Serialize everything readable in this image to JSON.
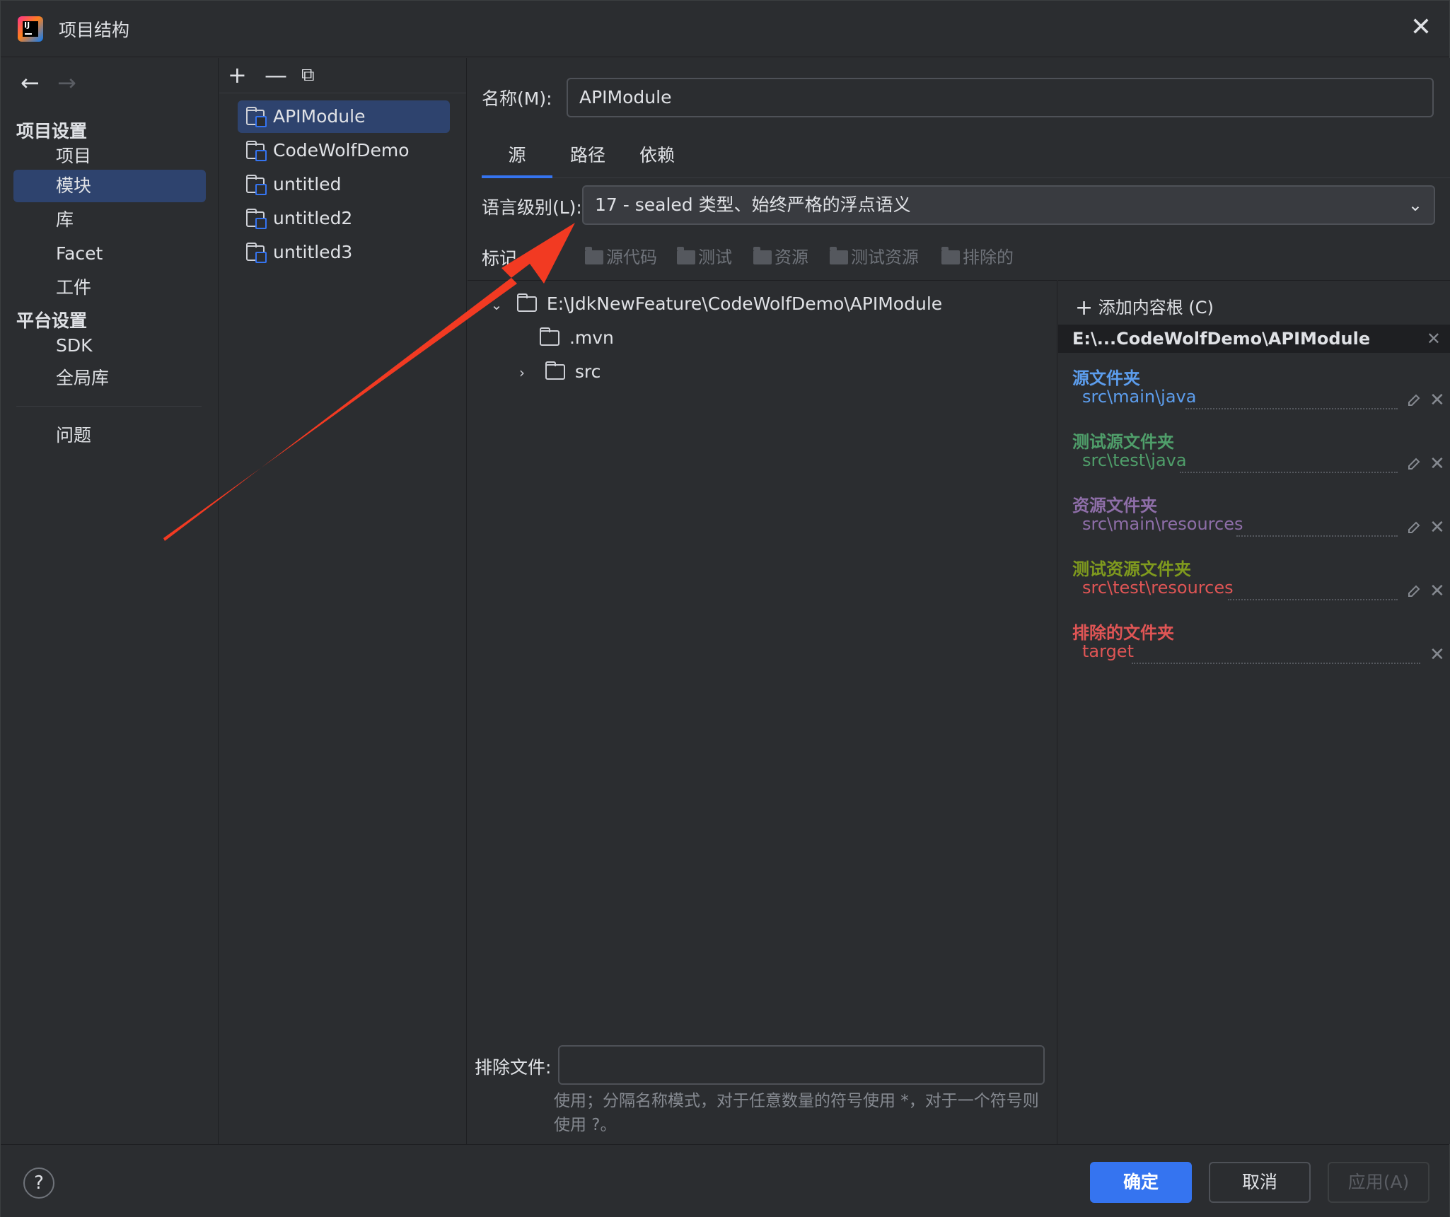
{
  "window": {
    "title": "项目结构"
  },
  "nav": {
    "project_settings_heading": "项目设置",
    "platform_settings_heading": "平台设置",
    "items": [
      {
        "label": "项目"
      },
      {
        "label": "模块"
      },
      {
        "label": "库"
      },
      {
        "label": "Facet"
      },
      {
        "label": "工件"
      },
      {
        "label": "SDK"
      },
      {
        "label": "全局库"
      },
      {
        "label": "问题"
      }
    ]
  },
  "modules": {
    "items": [
      {
        "label": "APIModule"
      },
      {
        "label": "CodeWolfDemo"
      },
      {
        "label": "untitled"
      },
      {
        "label": "untitled2"
      },
      {
        "label": "untitled3"
      }
    ]
  },
  "main": {
    "name_label": "名称(M):",
    "name_value": "APIModule",
    "tabs": [
      {
        "label": "源"
      },
      {
        "label": "路径"
      },
      {
        "label": "依赖"
      }
    ],
    "language_level_label": "语言级别(L):",
    "language_level_value": "17 - sealed 类型、始终严格的浮点语义",
    "mark_as_label": "标记",
    "mark_buttons": [
      {
        "label": "源代码"
      },
      {
        "label": "测试"
      },
      {
        "label": "资源"
      },
      {
        "label": "测试资源"
      },
      {
        "label": "排除的"
      }
    ],
    "tree": [
      {
        "label": "E:\\JdkNewFeature\\CodeWolfDemo\\APIModule"
      },
      {
        "label": ".mvn"
      },
      {
        "label": "src"
      }
    ],
    "exclude_files_label": "排除文件:",
    "exclude_files_value": "",
    "hint": "使用；分隔名称模式，对于任意数量的符号使用 *，对于一个符号则使用 ?。"
  },
  "roots": {
    "add_root_label": "添加内容根 (C)",
    "root_path": "E:\\...CodeWolfDemo\\APIModule",
    "groups": [
      {
        "title": "源文件夹",
        "path": "src\\main\\java",
        "color": "#5c9ded"
      },
      {
        "title": "测试源文件夹",
        "path": "src\\test\\java",
        "color": "#4f9e6a"
      },
      {
        "title": "资源文件夹",
        "path": "src\\main\\resources",
        "color": "#8e6ea8"
      },
      {
        "title": "测试资源文件夹",
        "path": "src\\test\\resources",
        "color": "#7f9a1e"
      },
      {
        "title": "排除的文件夹",
        "path": "target",
        "color": "#e05555"
      }
    ]
  },
  "footer": {
    "help": "?",
    "ok": "确定",
    "cancel": "取消",
    "apply": "应用(A)"
  },
  "colors": {
    "accent": "#3574f0",
    "selection": "#2e436e",
    "annotation_arrow": "#f23a22"
  }
}
